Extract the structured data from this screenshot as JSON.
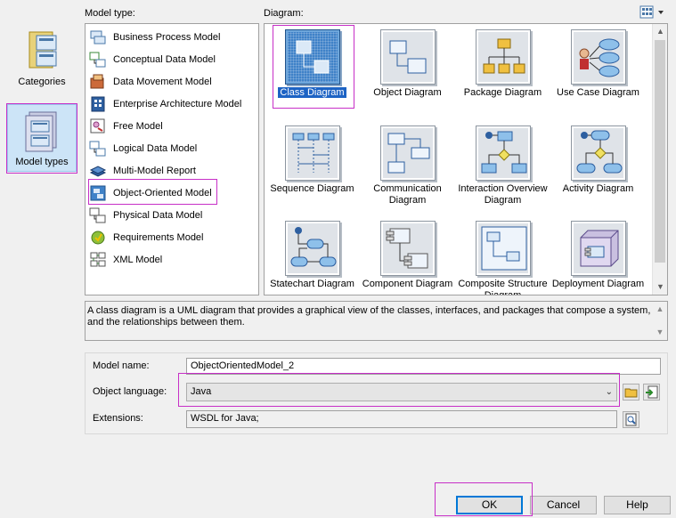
{
  "headers": {
    "model_type": "Model type:",
    "diagram": "Diagram:"
  },
  "categories": [
    {
      "label": "Categories",
      "icon": "categories-icon",
      "selected": false
    },
    {
      "label": "Model types",
      "icon": "model-types-icon",
      "selected": true
    }
  ],
  "model_types": [
    {
      "label": "Business Process Model",
      "icon": "business-process-model-icon"
    },
    {
      "label": "Conceptual Data Model",
      "icon": "conceptual-data-model-icon"
    },
    {
      "label": "Data Movement Model",
      "icon": "data-movement-model-icon"
    },
    {
      "label": "Enterprise Architecture Model",
      "icon": "enterprise-architecture-model-icon"
    },
    {
      "label": "Free Model",
      "icon": "free-model-icon"
    },
    {
      "label": "Logical Data Model",
      "icon": "logical-data-model-icon"
    },
    {
      "label": "Multi-Model Report",
      "icon": "multi-model-report-icon"
    },
    {
      "label": "Object-Oriented Model",
      "icon": "object-oriented-model-icon",
      "selected": true
    },
    {
      "label": "Physical Data Model",
      "icon": "physical-data-model-icon"
    },
    {
      "label": "Requirements Model",
      "icon": "requirements-model-icon"
    },
    {
      "label": "XML Model",
      "icon": "xml-model-icon"
    }
  ],
  "diagrams": [
    {
      "label": "Class Diagram",
      "icon": "class-diagram-icon",
      "selected": true
    },
    {
      "label": "Object Diagram",
      "icon": "object-diagram-icon"
    },
    {
      "label": "Package Diagram",
      "icon": "package-diagram-icon"
    },
    {
      "label": "Use Case Diagram",
      "icon": "use-case-diagram-icon"
    },
    {
      "label": "Sequence Diagram",
      "icon": "sequence-diagram-icon"
    },
    {
      "label": "Communication Diagram",
      "icon": "communication-diagram-icon"
    },
    {
      "label": "Interaction Overview Diagram",
      "icon": "interaction-overview-diagram-icon"
    },
    {
      "label": "Activity Diagram",
      "icon": "activity-diagram-icon"
    },
    {
      "label": "Statechart Diagram",
      "icon": "statechart-diagram-icon"
    },
    {
      "label": "Component Diagram",
      "icon": "component-diagram-icon"
    },
    {
      "label": "Composite Structure Diagram",
      "icon": "composite-structure-diagram-icon"
    },
    {
      "label": "Deployment Diagram",
      "icon": "deployment-diagram-icon"
    }
  ],
  "view_toggle": {
    "icon": "view-mode-icon"
  },
  "description": "A class diagram is a UML diagram that provides a graphical view of the classes, interfaces, and packages that compose a system, and the relationships between them.",
  "form": {
    "model_name_label": "Model name:",
    "model_name_value": "ObjectOrientedModel_2",
    "object_language_label": "Object language:",
    "object_language_value": "Java",
    "extensions_label": "Extensions:",
    "extensions_value": "WSDL for Java;"
  },
  "buttons": {
    "ok": "OK",
    "cancel": "Cancel",
    "help": "Help"
  },
  "colors": {
    "highlight": "#c72fc7",
    "selection": "#1d63c4",
    "accent": "#0078d7"
  }
}
